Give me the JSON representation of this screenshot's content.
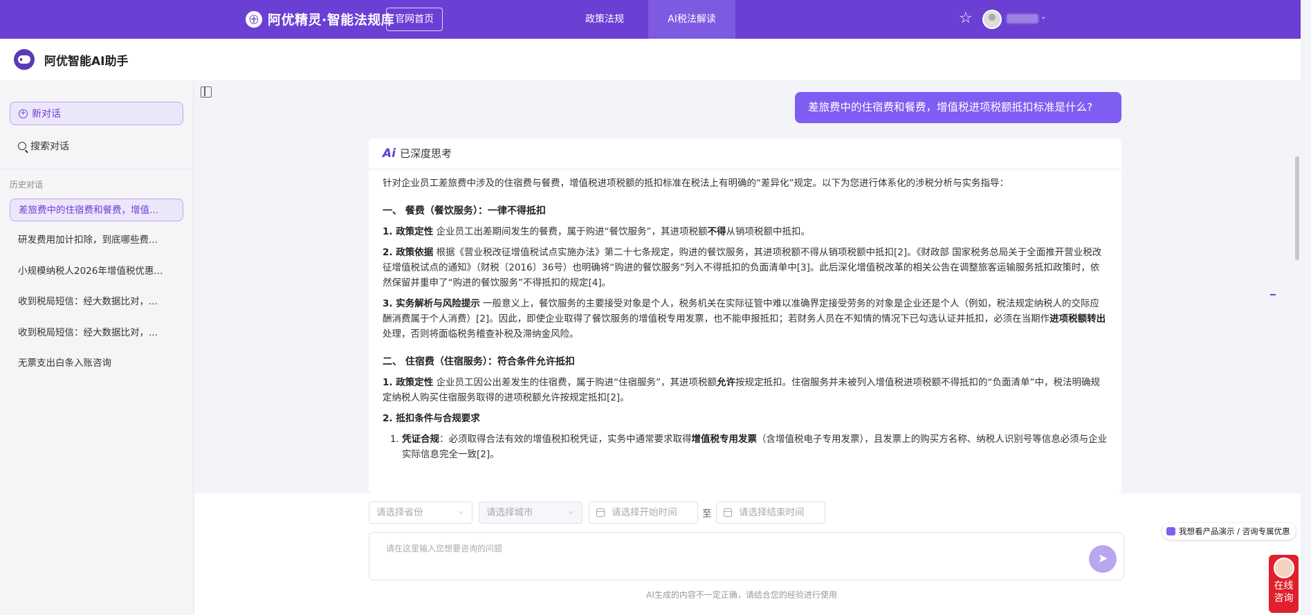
{
  "topbar": {
    "brand": "阿优精灵·智能法规库",
    "brand_icon": "㊉",
    "home_button": "官网首页",
    "nav": [
      "政策法规",
      "AI税法解读"
    ],
    "active_nav": "AI税法解读",
    "star_icon": "☆",
    "caret": "⌄",
    "bg_color": "#6a3fd4"
  },
  "subheader": {
    "title": "阿优智能AI助手"
  },
  "sidebar": {
    "new_chat": "新对话",
    "search_chat": "搜索对话",
    "history_label": "历史对话",
    "history": [
      "差旅费中的住宿费和餐费，增值...",
      "研发费用加计扣除，到底哪些费...",
      "小规模纳税人2026年增值税优惠...",
      "收到税局短信：经大数据比对，...",
      "收到税局短信：经大数据比对，...",
      "无票支出白条入账咨询"
    ]
  },
  "chat": {
    "user_message": "差旅费中的住宿费和餐费，增值税进项税额抵扣标准是什么?",
    "think_logo": "Ai",
    "think_label": "已深度思考",
    "intro": "针对企业员工差旅费中涉及的住宿费与餐费，增值税进项税额的抵扣标准在税法上有明确的“差异化”规定。以下为您进行体系化的涉税分析与实务指导：",
    "sec1_title": "一、 餐费（餐饮服务）：一律不得抵扣",
    "sec1_p1_b": "1. 政策定性",
    "sec1_p1_a": " 企业员工出差期间发生的餐费，属于购进“餐饮服务”，其进项税额",
    "sec1_p1_b2": "不得",
    "sec1_p1_c": "从销项税额中抵扣。",
    "sec1_p2_b": "2. 政策依据",
    "sec1_p2": " 根据《营业税改征增值税试点实施办法》第二十七条规定，购进的餐饮服务，其进项税额不得从销项税额中抵扣[2]。《财政部 国家税务总局关于全面推开营业税改征增值税试点的通知》（财税〔2016〕36号）也明确将“购进的餐饮服务”列入不得抵扣的负面清单中[3]。此后深化增值税改革的相关公告在调整旅客运输服务抵扣政策时，依然保留并重申了“购进的餐饮服务”不得抵扣的规定[4]。",
    "sec1_p3_b": "3. 实务解析与风险提示",
    "sec1_p3_a": " 一般意义上，餐饮服务的主要接受对象是个人，税务机关在实际征管中难以准确界定接受劳务的对象是企业还是个人（例如，税法规定纳税人的交际应酬消费属于个人消费）[2]。因此，即使企业取得了餐饮服务的增值税专用发票，也不能申报抵扣；若财务人员在不知情的情况下已勾选认证并抵扣，必须在当期作",
    "sec1_p3_b2": "进项税额转出",
    "sec1_p3_c": "处理，否则将面临税务稽查补税及滞纳金风险。",
    "sec2_title": "二、 住宿费（住宿服务）：符合条件允许抵扣",
    "sec2_p1_b": "1. 政策定性",
    "sec2_p1_a": " 企业员工因公出差发生的住宿费，属于购进“住宿服务”，其进项税额",
    "sec2_p1_b2": "允许",
    "sec2_p1_c": "按规定抵扣。住宿服务并未被列入增值税进项税额不得抵扣的“负面清单”中，税法明确规定纳税人购买住宿服务取得的进项税额允许按规定抵扣[2]。",
    "sec2_p2_b": "2. 抵扣条件与合规要求",
    "sec2_li1_b": "凭证合规",
    "sec2_li1_a": "：必须取得合法有效的增值税扣税凭证，实务中通常要求取得",
    "sec2_li1_b2": "增值税专用发票",
    "sec2_li1_c": "（含增值税电子专用发票），且发票上的购买方名称、纳税人识别号等信息必须与企业实际信息完全一致[2]。"
  },
  "input": {
    "province_placeholder": "请选择省份",
    "city_placeholder": "请选择城市",
    "start_placeholder": "请选择开始时间",
    "to_label": "至",
    "end_placeholder": "请选择结束时间",
    "question_placeholder": "请在这里输入您想要咨询的问题",
    "send_icon": "➤",
    "disclaimer": "AI生成的内容不一定正确，请结合您的经验进行使用"
  },
  "widgets": {
    "promo": "我想看产品演示 / 咨询专属优惠",
    "online_1": "在线",
    "online_2": "咨询"
  }
}
